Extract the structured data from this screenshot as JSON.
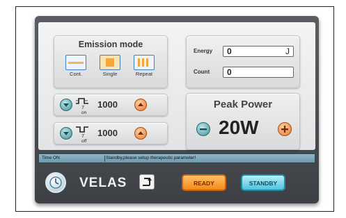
{
  "emission": {
    "title": "Emission mode",
    "modes": [
      {
        "label": "Cont.",
        "icon": "continuous-wave-icon"
      },
      {
        "label": "Single",
        "icon": "single-pulse-icon"
      },
      {
        "label": "Repeat",
        "icon": "repeat-pulse-icon"
      }
    ]
  },
  "timing": {
    "t_on": {
      "label": "T on",
      "value": "1000"
    },
    "t_off": {
      "label": "T off",
      "value": "1000"
    }
  },
  "energy": {
    "energy_label": "Energy",
    "energy_value": "0",
    "energy_unit": "J",
    "count_label": "Count",
    "count_value": "0"
  },
  "peak_power": {
    "title": "Peak Power",
    "value": "20W"
  },
  "status": {
    "left": "Time ON",
    "message": "Standby,please setup therapeutic parameter!"
  },
  "bottom": {
    "brand": "VELAS",
    "ready_label": "READY",
    "standby_label": "STANDBY"
  },
  "colors": {
    "accent_ready": "#f58a18",
    "accent_standby": "#4fc4dc",
    "device_body": "#4a4d52"
  }
}
